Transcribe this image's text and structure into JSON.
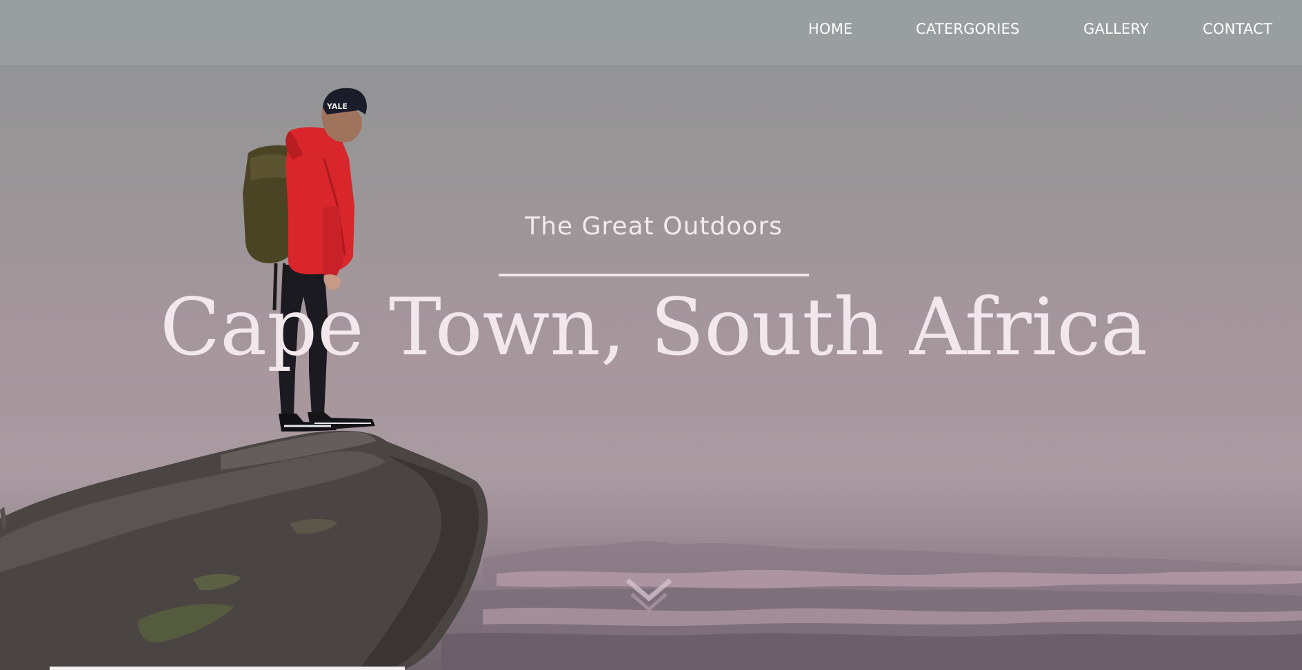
{
  "nav": {
    "items": [
      {
        "label": "HOME"
      },
      {
        "label": "CATERGORIES"
      },
      {
        "label": "GALLERY"
      },
      {
        "label": "CONTACT"
      }
    ]
  },
  "hero": {
    "subtitle": "The Great Outdoors",
    "headline": "Cape Town, South Africa"
  },
  "icons": {
    "scroll": "chevron-down-icon"
  },
  "colors": {
    "jacket": "#d8262b",
    "text": "#f2e8ec",
    "topbar": "#a0a6a6"
  }
}
